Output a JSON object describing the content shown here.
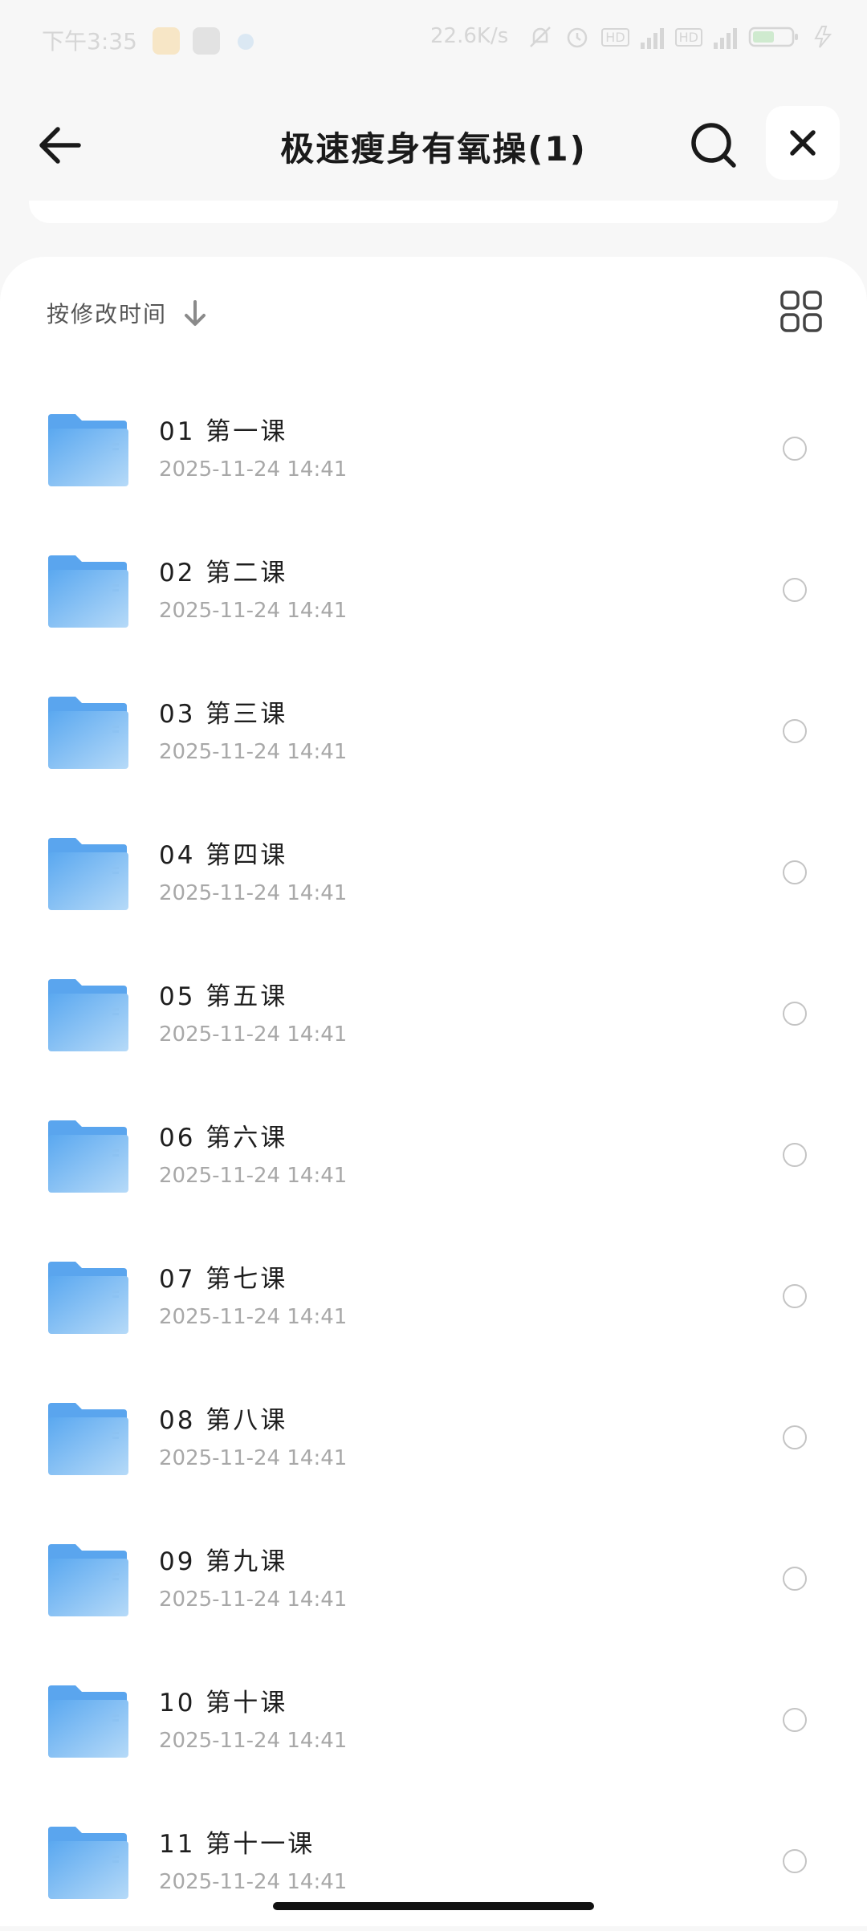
{
  "status_bar": {
    "time": "下午3:35",
    "network_speed": "22.6K/s"
  },
  "header": {
    "title": "极速瘦身有氧操(1)"
  },
  "sort": {
    "label": "按修改时间"
  },
  "files": [
    {
      "name": "01 第一课",
      "date": "2025-11-24  14:41"
    },
    {
      "name": "02 第二课",
      "date": "2025-11-24  14:41"
    },
    {
      "name": "03 第三课",
      "date": "2025-11-24  14:41"
    },
    {
      "name": "04 第四课",
      "date": "2025-11-24  14:41"
    },
    {
      "name": "05 第五课",
      "date": "2025-11-24  14:41"
    },
    {
      "name": "06 第六课",
      "date": "2025-11-24  14:41"
    },
    {
      "name": "07 第七课",
      "date": "2025-11-24  14:41"
    },
    {
      "name": "08 第八课",
      "date": "2025-11-24  14:41"
    },
    {
      "name": "09 第九课",
      "date": "2025-11-24  14:41"
    },
    {
      "name": "10 第十课",
      "date": "2025-11-24  14:41"
    },
    {
      "name": "11 第十一课",
      "date": "2025-11-24  14:41"
    }
  ],
  "icons": {
    "back": "arrow-left-icon",
    "search": "search-icon",
    "close": "close-icon",
    "sort_direction": "arrow-down-icon",
    "view_toggle": "grid-view-icon",
    "folder": "folder-icon"
  },
  "colors": {
    "folder": "#6fb2f2",
    "background": "#f7f7f7",
    "surface": "#ffffff"
  }
}
